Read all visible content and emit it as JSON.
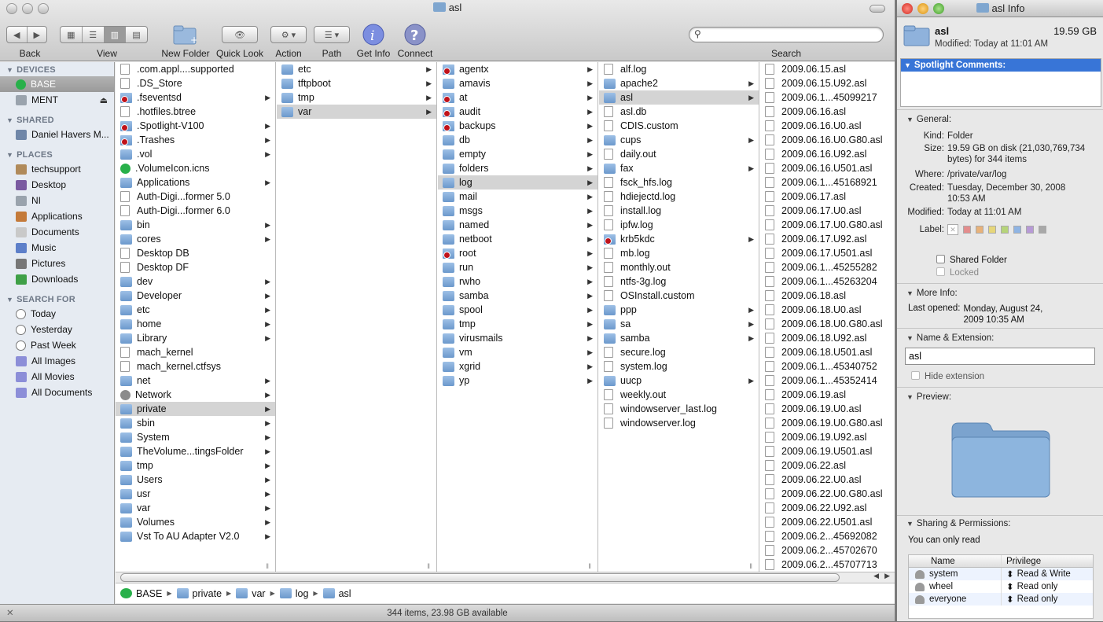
{
  "window": {
    "title": "asl"
  },
  "toolbar": {
    "back_label": "Back",
    "view_label": "View",
    "new_folder_label": "New Folder",
    "quick_look_label": "Quick Look",
    "action_label": "Action",
    "path_label": "Path",
    "get_info_label": "Get Info",
    "connect_label": "Connect",
    "search_label": "Search",
    "search_placeholder": ""
  },
  "sidebar": {
    "devices_header": "DEVICES",
    "devices": [
      {
        "label": "BASE",
        "icon": "disk-icon"
      },
      {
        "label": "MENT",
        "icon": "disk-icon"
      }
    ],
    "shared_header": "SHARED",
    "shared": [
      {
        "label": "Daniel Havers M...",
        "icon": "computer-icon"
      }
    ],
    "places_header": "PLACES",
    "places": [
      {
        "label": "techsupport",
        "icon": "home-icon"
      },
      {
        "label": "Desktop",
        "icon": "desktop-icon"
      },
      {
        "label": "NI",
        "icon": "disk-icon"
      },
      {
        "label": "Applications",
        "icon": "applications-icon"
      },
      {
        "label": "Documents",
        "icon": "documents-icon"
      },
      {
        "label": "Music",
        "icon": "music-icon"
      },
      {
        "label": "Pictures",
        "icon": "pictures-icon"
      },
      {
        "label": "Downloads",
        "icon": "downloads-icon"
      }
    ],
    "search_header": "SEARCH FOR",
    "searches": [
      {
        "label": "Today",
        "icon": "clock-icon"
      },
      {
        "label": "Yesterday",
        "icon": "clock-icon"
      },
      {
        "label": "Past Week",
        "icon": "clock-icon"
      },
      {
        "label": "All Images",
        "icon": "smart-folder-icon"
      },
      {
        "label": "All Movies",
        "icon": "smart-folder-icon"
      },
      {
        "label": "All Documents",
        "icon": "smart-folder-icon"
      }
    ]
  },
  "columns": [
    [
      {
        "n": ".com.appl....supported",
        "t": "doc",
        "a": false
      },
      {
        "n": ".DS_Store",
        "t": "doc",
        "a": false
      },
      {
        "n": ".fseventsd",
        "t": "red",
        "a": true
      },
      {
        "n": ".hotfiles.btree",
        "t": "doc",
        "a": false
      },
      {
        "n": ".Spotlight-V100",
        "t": "red",
        "a": true
      },
      {
        "n": ".Trashes",
        "t": "red",
        "a": true
      },
      {
        "n": ".vol",
        "t": "folder",
        "a": true
      },
      {
        "n": ".VolumeIcon.icns",
        "t": "green",
        "a": false
      },
      {
        "n": "Applications",
        "t": "folder",
        "a": true
      },
      {
        "n": "Auth-Digi...former 5.0",
        "t": "doc",
        "a": false
      },
      {
        "n": "Auth-Digi...former 6.0",
        "t": "doc",
        "a": false
      },
      {
        "n": "bin",
        "t": "folder",
        "a": true
      },
      {
        "n": "cores",
        "t": "folder",
        "a": true
      },
      {
        "n": "Desktop DB",
        "t": "doc",
        "a": false
      },
      {
        "n": "Desktop DF",
        "t": "doc",
        "a": false
      },
      {
        "n": "dev",
        "t": "folder",
        "a": true
      },
      {
        "n": "Developer",
        "t": "folder",
        "a": true
      },
      {
        "n": "etc",
        "t": "folder",
        "a": true
      },
      {
        "n": "home",
        "t": "folder",
        "a": true
      },
      {
        "n": "Library",
        "t": "folder",
        "a": true
      },
      {
        "n": "mach_kernel",
        "t": "doc",
        "a": false
      },
      {
        "n": "mach_kernel.ctfsys",
        "t": "doc",
        "a": false
      },
      {
        "n": "net",
        "t": "folder",
        "a": true
      },
      {
        "n": "Network",
        "t": "gray",
        "a": true
      },
      {
        "n": "private",
        "t": "folder",
        "a": true,
        "sel": true
      },
      {
        "n": "sbin",
        "t": "folder",
        "a": true
      },
      {
        "n": "System",
        "t": "folder",
        "a": true
      },
      {
        "n": "TheVolume...tingsFolder",
        "t": "folder",
        "a": true
      },
      {
        "n": "tmp",
        "t": "folder",
        "a": true
      },
      {
        "n": "Users",
        "t": "folder",
        "a": true
      },
      {
        "n": "usr",
        "t": "folder",
        "a": true
      },
      {
        "n": "var",
        "t": "folder",
        "a": true
      },
      {
        "n": "Volumes",
        "t": "folder",
        "a": true
      },
      {
        "n": "Vst To AU Adapter V2.0",
        "t": "folder",
        "a": true
      }
    ],
    [
      {
        "n": "etc",
        "t": "folder",
        "a": true
      },
      {
        "n": "tftpboot",
        "t": "folder",
        "a": true
      },
      {
        "n": "tmp",
        "t": "folder",
        "a": true
      },
      {
        "n": "var",
        "t": "folder",
        "a": true,
        "sel": true
      }
    ],
    [
      {
        "n": "agentx",
        "t": "red",
        "a": true
      },
      {
        "n": "amavis",
        "t": "folder",
        "a": true
      },
      {
        "n": "at",
        "t": "red",
        "a": true
      },
      {
        "n": "audit",
        "t": "red",
        "a": true
      },
      {
        "n": "backups",
        "t": "red",
        "a": true
      },
      {
        "n": "db",
        "t": "folder",
        "a": true
      },
      {
        "n": "empty",
        "t": "folder",
        "a": true
      },
      {
        "n": "folders",
        "t": "folder",
        "a": true
      },
      {
        "n": "log",
        "t": "folder",
        "a": true,
        "sel": true
      },
      {
        "n": "mail",
        "t": "folder",
        "a": true
      },
      {
        "n": "msgs",
        "t": "folder",
        "a": true
      },
      {
        "n": "named",
        "t": "folder",
        "a": true
      },
      {
        "n": "netboot",
        "t": "folder",
        "a": true
      },
      {
        "n": "root",
        "t": "red",
        "a": true
      },
      {
        "n": "run",
        "t": "folder",
        "a": true
      },
      {
        "n": "rwho",
        "t": "folder",
        "a": true
      },
      {
        "n": "samba",
        "t": "folder",
        "a": true
      },
      {
        "n": "spool",
        "t": "folder",
        "a": true
      },
      {
        "n": "tmp",
        "t": "folder",
        "a": true
      },
      {
        "n": "virusmails",
        "t": "folder",
        "a": true
      },
      {
        "n": "vm",
        "t": "folder",
        "a": true
      },
      {
        "n": "xgrid",
        "t": "folder",
        "a": true
      },
      {
        "n": "yp",
        "t": "folder",
        "a": true
      }
    ],
    [
      {
        "n": "alf.log",
        "t": "doc",
        "a": false
      },
      {
        "n": "apache2",
        "t": "folder",
        "a": true
      },
      {
        "n": "asl",
        "t": "folder",
        "a": true,
        "sel": true
      },
      {
        "n": "asl.db",
        "t": "doc",
        "a": false
      },
      {
        "n": "CDIS.custom",
        "t": "doc",
        "a": false
      },
      {
        "n": "cups",
        "t": "folder",
        "a": true
      },
      {
        "n": "daily.out",
        "t": "doc",
        "a": false
      },
      {
        "n": "fax",
        "t": "folder",
        "a": true
      },
      {
        "n": "fsck_hfs.log",
        "t": "doc",
        "a": false
      },
      {
        "n": "hdiejectd.log",
        "t": "doc",
        "a": false
      },
      {
        "n": "install.log",
        "t": "doc",
        "a": false
      },
      {
        "n": "ipfw.log",
        "t": "doc",
        "a": false
      },
      {
        "n": "krb5kdc",
        "t": "red",
        "a": true
      },
      {
        "n": "mb.log",
        "t": "doc",
        "a": false
      },
      {
        "n": "monthly.out",
        "t": "doc",
        "a": false
      },
      {
        "n": "ntfs-3g.log",
        "t": "doc",
        "a": false
      },
      {
        "n": "OSInstall.custom",
        "t": "doc",
        "a": false
      },
      {
        "n": "ppp",
        "t": "folder",
        "a": true
      },
      {
        "n": "sa",
        "t": "folder",
        "a": true
      },
      {
        "n": "samba",
        "t": "folder",
        "a": true
      },
      {
        "n": "secure.log",
        "t": "doc",
        "a": false
      },
      {
        "n": "system.log",
        "t": "doc",
        "a": false
      },
      {
        "n": "uucp",
        "t": "folder",
        "a": true
      },
      {
        "n": "weekly.out",
        "t": "doc",
        "a": false
      },
      {
        "n": "windowserver_last.log",
        "t": "doc",
        "a": false
      },
      {
        "n": "windowserver.log",
        "t": "doc",
        "a": false
      }
    ],
    [
      {
        "n": "2009.06.15.asl",
        "t": "doc",
        "a": false
      },
      {
        "n": "2009.06.15.U92.asl",
        "t": "doc",
        "a": false
      },
      {
        "n": "2009.06.1...45099217",
        "t": "doc",
        "a": false
      },
      {
        "n": "2009.06.16.asl",
        "t": "doc",
        "a": false
      },
      {
        "n": "2009.06.16.U0.asl",
        "t": "doc",
        "a": false
      },
      {
        "n": "2009.06.16.U0.G80.asl",
        "t": "doc",
        "a": false
      },
      {
        "n": "2009.06.16.U92.asl",
        "t": "doc",
        "a": false
      },
      {
        "n": "2009.06.16.U501.asl",
        "t": "doc",
        "a": false
      },
      {
        "n": "2009.06.1...45168921",
        "t": "doc",
        "a": false
      },
      {
        "n": "2009.06.17.asl",
        "t": "doc",
        "a": false
      },
      {
        "n": "2009.06.17.U0.asl",
        "t": "doc",
        "a": false
      },
      {
        "n": "2009.06.17.U0.G80.asl",
        "t": "doc",
        "a": false
      },
      {
        "n": "2009.06.17.U92.asl",
        "t": "doc",
        "a": false
      },
      {
        "n": "2009.06.17.U501.asl",
        "t": "doc",
        "a": false
      },
      {
        "n": "2009.06.1...45255282",
        "t": "doc",
        "a": false
      },
      {
        "n": "2009.06.1...45263204",
        "t": "doc",
        "a": false
      },
      {
        "n": "2009.06.18.asl",
        "t": "doc",
        "a": false
      },
      {
        "n": "2009.06.18.U0.asl",
        "t": "doc",
        "a": false
      },
      {
        "n": "2009.06.18.U0.G80.asl",
        "t": "doc",
        "a": false
      },
      {
        "n": "2009.06.18.U92.asl",
        "t": "doc",
        "a": false
      },
      {
        "n": "2009.06.18.U501.asl",
        "t": "doc",
        "a": false
      },
      {
        "n": "2009.06.1...45340752",
        "t": "doc",
        "a": false
      },
      {
        "n": "2009.06.1...45352414",
        "t": "doc",
        "a": false
      },
      {
        "n": "2009.06.19.asl",
        "t": "doc",
        "a": false
      },
      {
        "n": "2009.06.19.U0.asl",
        "t": "doc",
        "a": false
      },
      {
        "n": "2009.06.19.U0.G80.asl",
        "t": "doc",
        "a": false
      },
      {
        "n": "2009.06.19.U92.asl",
        "t": "doc",
        "a": false
      },
      {
        "n": "2009.06.19.U501.asl",
        "t": "doc",
        "a": false
      },
      {
        "n": "2009.06.22.asl",
        "t": "doc",
        "a": false
      },
      {
        "n": "2009.06.22.U0.asl",
        "t": "doc",
        "a": false
      },
      {
        "n": "2009.06.22.U0.G80.asl",
        "t": "doc",
        "a": false
      },
      {
        "n": "2009.06.22.U92.asl",
        "t": "doc",
        "a": false
      },
      {
        "n": "2009.06.22.U501.asl",
        "t": "doc",
        "a": false
      },
      {
        "n": "2009.06.2...45692082",
        "t": "doc",
        "a": false
      },
      {
        "n": "2009.06.2...45702670",
        "t": "doc",
        "a": false
      },
      {
        "n": "2009.06.2...45707713",
        "t": "doc",
        "a": false
      }
    ]
  ],
  "pathbar": [
    "BASE",
    "private",
    "var",
    "log",
    "asl"
  ],
  "status": "344 items, 23.98 GB available",
  "info": {
    "title": "asl Info",
    "name": "asl",
    "size": "19.59 GB",
    "modified_line": "Modified: Today at 11:01 AM",
    "spotlight_header": "Spotlight Comments:",
    "general_header": "General:",
    "kind_k": "Kind:",
    "kind_v": "Folder",
    "size_k": "Size:",
    "size_v": "19.59 GB on disk (21,030,769,734 bytes) for 344 items",
    "where_k": "Where:",
    "where_v": "/private/var/log",
    "created_k": "Created:",
    "created_v": "Tuesday, December 30, 2008 10:53 AM",
    "modified_k": "Modified:",
    "modified_v": "Today at 11:01 AM",
    "label_k": "Label:",
    "label_colors": [
      "#e38d8d",
      "#e8b27a",
      "#e6d67a",
      "#b6d47a",
      "#8fb4e3",
      "#b79ad6",
      "#a8a8a8"
    ],
    "shared_folder": "Shared Folder",
    "locked": "Locked",
    "more_info_header": "More Info:",
    "last_opened_k": "Last opened:",
    "last_opened_v": "Monday, August 24, 2009 10:35 AM",
    "name_ext_header": "Name & Extension:",
    "name_value": "asl",
    "hide_extension": "Hide extension",
    "preview_header": "Preview:",
    "sharing_header": "Sharing & Permissions:",
    "you_can": "You can only read",
    "perm_name_col": "Name",
    "perm_priv_col": "Privilege",
    "permissions": [
      {
        "name": "system",
        "priv": "Read & Write"
      },
      {
        "name": "wheel",
        "priv": "Read only"
      },
      {
        "name": "everyone",
        "priv": "Read only"
      }
    ]
  }
}
